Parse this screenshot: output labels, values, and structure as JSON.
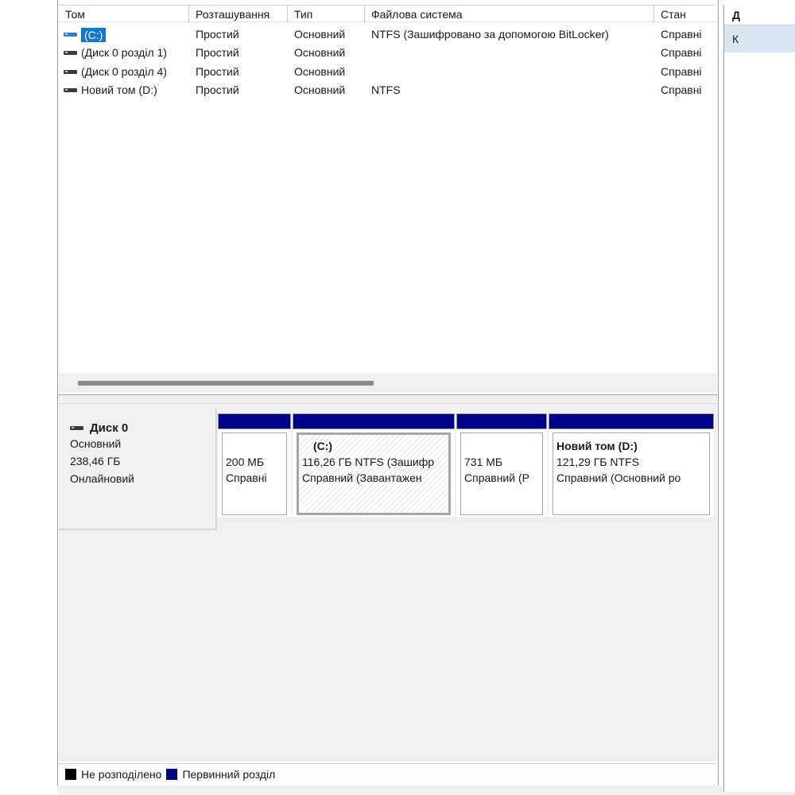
{
  "volume_list": {
    "columns": [
      "Том",
      "Розташування",
      "Тип",
      "Файлова система",
      "Стан"
    ],
    "rows": [
      {
        "name": "(C:)",
        "location": "Простий",
        "type": "Основний",
        "fs": "NTFS (Зашифровано за допомогою BitLocker)",
        "status": "Справні",
        "icon": "drive-icon-blue",
        "selected": true
      },
      {
        "name": "(Диск 0 розділ 1)",
        "location": "Простий",
        "type": "Основний",
        "fs": "",
        "status": "Справні",
        "icon": "drive-icon"
      },
      {
        "name": "(Диск 0 розділ 4)",
        "location": "Простий",
        "type": "Основний",
        "fs": "",
        "status": "Справні",
        "icon": "drive-icon"
      },
      {
        "name": "Новий том (D:)",
        "location": "Простий",
        "type": "Основний",
        "fs": "NTFS",
        "status": "Справні",
        "icon": "drive-icon"
      }
    ]
  },
  "disk": {
    "name": "Диск 0",
    "kind": "Основний",
    "size": "238,46 ГБ",
    "state": "Онлайновий",
    "partitions": [
      {
        "name": "",
        "line1": "200 МБ",
        "line2": "Справні"
      },
      {
        "name": "(C:)",
        "line1": "116,26 ГБ NTFS (Зашифр",
        "line2": "Справний (Завантажен",
        "selected": true
      },
      {
        "name": "",
        "line1": "731 МБ",
        "line2": "Справний (Р"
      },
      {
        "name": "Новий том  (D:)",
        "line1": "121,29 ГБ NTFS",
        "line2": "Справний (Основний ро"
      }
    ]
  },
  "legend": {
    "unallocated": "Не розподілено",
    "primary": "Первинний розділ",
    "colors": {
      "unallocated": "#000000",
      "primary": "#00008b"
    }
  },
  "action_pane": {
    "header": "Д",
    "item": "К"
  },
  "colors": {
    "partition_bar": "#00008b",
    "selection": "#0f78d7"
  }
}
